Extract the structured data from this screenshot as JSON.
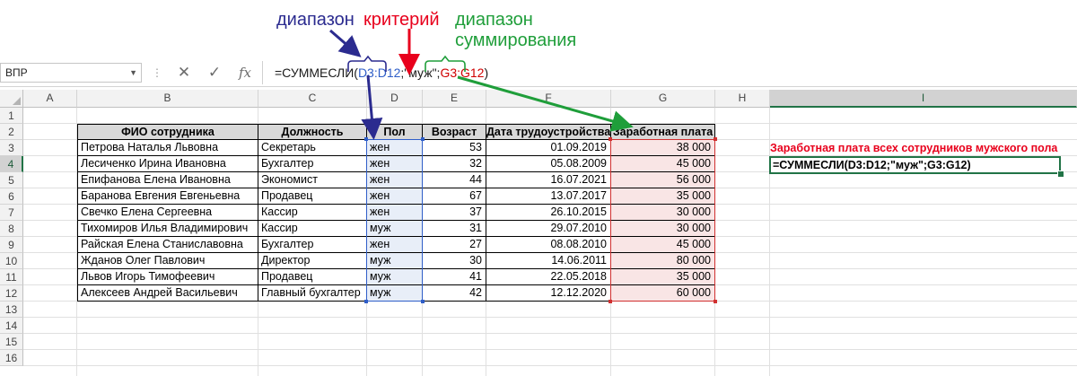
{
  "annotations": {
    "range": "диапазон",
    "criterion": "критерий",
    "sum_range_line1": "диапазон",
    "sum_range_line2": "суммирования"
  },
  "formula_bar": {
    "name_box": "ВПР",
    "formula_prefix": "=СУММЕСЛИ(",
    "arg1": "D3:D12",
    "sep1": ";",
    "arg2": "\"муж\"",
    "sep2": ";",
    "arg3": "G3:G12",
    "formula_suffix": ")"
  },
  "columns": [
    "A",
    "B",
    "C",
    "D",
    "E",
    "F",
    "G",
    "H",
    "I"
  ],
  "active_column": "I",
  "rows": [
    "1",
    "2",
    "3",
    "4",
    "5",
    "6",
    "7",
    "8",
    "9",
    "10",
    "11",
    "12",
    "13",
    "14",
    "15",
    "16"
  ],
  "active_row": "4",
  "table": {
    "headers": [
      "ФИО сотрудника",
      "Должность",
      "Пол",
      "Возраст",
      "Дата трудоустройства",
      "Заработная плата"
    ],
    "rows": [
      [
        "Петрова Наталья Львовна",
        "Секретарь",
        "жен",
        "53",
        "01.09.2019",
        "38 000"
      ],
      [
        "Лесиченко Ирина Ивановна",
        "Бухгалтер",
        "жен",
        "32",
        "05.08.2009",
        "45 000"
      ],
      [
        "Епифанова Елена Ивановна",
        "Экономист",
        "жен",
        "44",
        "16.07.2021",
        "56 000"
      ],
      [
        "Баранова Евгения Евгеньевна",
        "Продавец",
        "жен",
        "67",
        "13.07.2017",
        "35 000"
      ],
      [
        "Свечко Елена Сергеевна",
        "Кассир",
        "жен",
        "37",
        "26.10.2015",
        "30 000"
      ],
      [
        "Тихомиров Илья Владимирович",
        "Кассир",
        "муж",
        "31",
        "29.07.2010",
        "30 000"
      ],
      [
        "Райская Елена Станиславовна",
        "Бухгалтер",
        "жен",
        "27",
        "08.08.2010",
        "45 000"
      ],
      [
        "Жданов Олег Павлович",
        "Директор",
        "муж",
        "30",
        "14.06.2011",
        "80 000"
      ],
      [
        "Львов Игорь Тимофеевич",
        "Продавец",
        "муж",
        "41",
        "22.05.2018",
        "35 000"
      ],
      [
        "Алексеев Андрей Васильевич",
        "Главный бухгалтер",
        "муж",
        "42",
        "12.12.2020",
        "60 000"
      ]
    ]
  },
  "side_note": "Заработная плата всех сотрудников мужского пола",
  "active_cell_formula": "=СУММЕСЛИ(D3:D12;\"муж\";G3:G12)",
  "colors": {
    "annotation_range": "#2b2b8f",
    "annotation_criterion": "#e8001c",
    "annotation_sum_range": "#1f9e3a",
    "range_highlight": "#e8eef8",
    "sum_range_highlight": "#f9e5e5",
    "header_fill": "#d9d9d9",
    "excel_green": "#217346"
  }
}
